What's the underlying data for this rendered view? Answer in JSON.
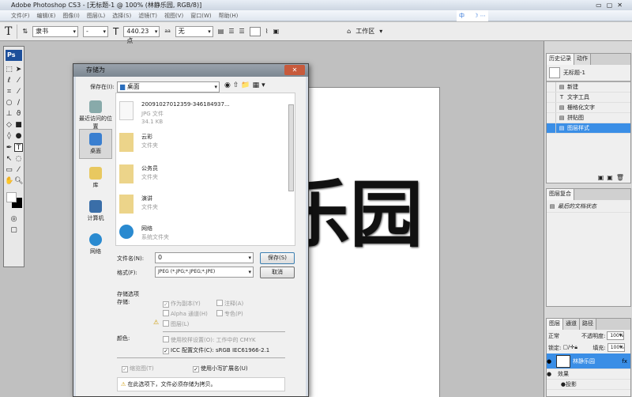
{
  "window": {
    "title": "Adobe Photoshop CS3 - [无标题-1 @ 100% (林静乐园, RGB/8)]"
  },
  "menu": [
    "文件(F)",
    "编辑(E)",
    "图像(I)",
    "图层(L)",
    "选择(S)",
    "滤镜(T)",
    "视图(V)",
    "窗口(W)",
    "帮助(H)"
  ],
  "options": {
    "tool": "T",
    "font": "隶书",
    "style": "-",
    "size": "440.23 点",
    "aa_icon": "aa",
    "aa": "无",
    "workspace": "工作区"
  },
  "ime": "中",
  "toolbox": {
    "logo": "Ps"
  },
  "canvas": {
    "text_visible": "乐园"
  },
  "dialog": {
    "title": "存储为",
    "save_in_label": "保存在(I):",
    "save_in_value": "桌面",
    "places": [
      "最近访问的位置",
      "桌面",
      "库",
      "计算机",
      "网络"
    ],
    "files": [
      {
        "name": "20091027012359-346184937...",
        "type": "JPG 文件",
        "size": "34.1 KB"
      },
      {
        "name": "云彩",
        "type": "文件夹"
      },
      {
        "name": "公务员",
        "type": "文件夹"
      },
      {
        "name": "演讲",
        "type": "文件夹"
      },
      {
        "name": "网络",
        "type": "系统文件夹"
      }
    ],
    "filename_label": "文件名(N):",
    "filename_value": "0",
    "format_label": "格式(F):",
    "format_value": "JPEG (*.JPG;*.JPEG;*.JPE)",
    "save_button": "保存(S)",
    "cancel_button": "取消",
    "save_options_title": "存储选项",
    "store_label": "存储:",
    "opt_copy": "作为副本(Y)",
    "opt_notes": "注释(A)",
    "opt_alpha": "Alpha 通道(H)",
    "opt_spot": "专色(P)",
    "opt_layers": "图层(L)",
    "color_label": "颜色:",
    "opt_proof": "使用校样设置(O): 工作中的 CMYK",
    "opt_icc": "ICC 配置文件(C): sRGB IEC61966-2.1",
    "opt_thumb": "缩览图(T)",
    "opt_lower": "使用小写扩展名(U)",
    "warning": "在此选项下，文件必须存储为拷贝。"
  },
  "history": {
    "tabs": [
      "历史记录",
      "动作"
    ],
    "snapshot": "无标题-1",
    "items": [
      "新建",
      "文字工具",
      "栅格化文字",
      "拼贴图",
      "图层样式"
    ],
    "selected": 4
  },
  "comps": {
    "tabs": [
      "图层复合"
    ],
    "item": "最后的文档状态"
  },
  "layers": {
    "tabs": [
      "图层",
      "通道",
      "路径"
    ],
    "blend": "正常",
    "opacity_label": "不透明度:",
    "opacity": "100%",
    "lock_label": "锁定:",
    "fill_label": "填充:",
    "fill": "100%",
    "layer_name": "林静乐园",
    "fx": "fx",
    "effects": "效果",
    "effect1": "投影"
  }
}
